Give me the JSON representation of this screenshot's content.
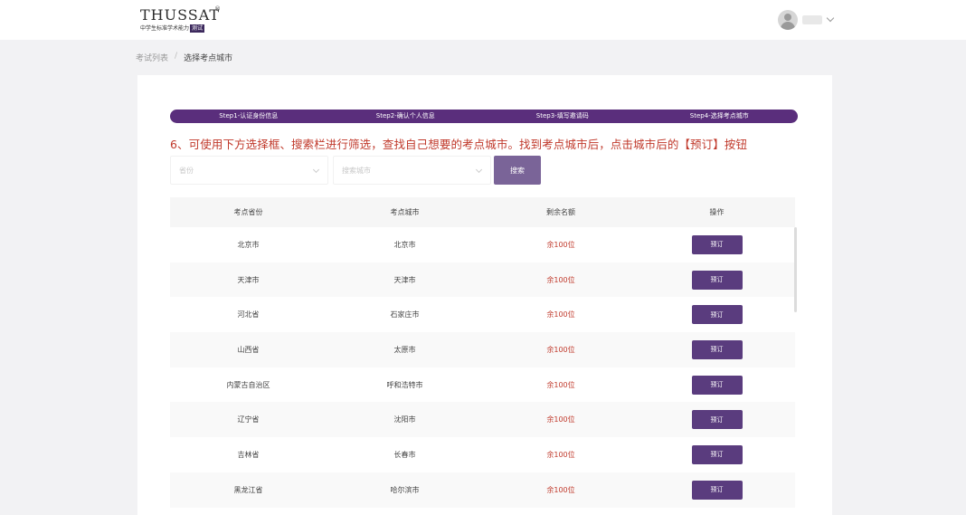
{
  "header": {
    "logo_main": "THUSSAT",
    "logo_reg": "®",
    "logo_subtitle": "中学生标准学术能力",
    "logo_tag": "测试",
    "user_chevron": "chevron-down-icon"
  },
  "breadcrumb": {
    "parent": "考试列表",
    "separator": "/",
    "current": "选择考点城市"
  },
  "steps": [
    {
      "label": "Step1-认证身份信息"
    },
    {
      "label": "Step2-确认个人信息"
    },
    {
      "label": "Step3-填写邀请码"
    },
    {
      "label": "Step4-选择考点城市"
    }
  ],
  "instruction": "6、可使用下方选择框、搜索栏进行筛选，查找自己想要的考点城市。找到考点城市后，点击城市后的【预订】按钮",
  "filters": {
    "province_placeholder": "省份",
    "city_placeholder": "搜索城市",
    "search_label": "搜索"
  },
  "table": {
    "headers": [
      "考点省份",
      "考点城市",
      "剩余名额",
      "操作"
    ],
    "book_label": "预订",
    "rows": [
      {
        "province": "北京市",
        "city": "北京市",
        "remaining": "余100位"
      },
      {
        "province": "天津市",
        "city": "天津市",
        "remaining": "余100位"
      },
      {
        "province": "河北省",
        "city": "石家庄市",
        "remaining": "余100位"
      },
      {
        "province": "山西省",
        "city": "太原市",
        "remaining": "余100位"
      },
      {
        "province": "内蒙古自治区",
        "city": "呼和浩特市",
        "remaining": "余100位"
      },
      {
        "province": "辽宁省",
        "city": "沈阳市",
        "remaining": "余100位"
      },
      {
        "province": "吉林省",
        "city": "长春市",
        "remaining": "余100位"
      },
      {
        "province": "黑龙江省",
        "city": "哈尔滨市",
        "remaining": "余100位"
      }
    ]
  },
  "colors": {
    "brand_purple": "#5a2e7c",
    "button_purple": "#5a3c7e",
    "search_button": "#7a6498",
    "remaining_red": "#c0392b"
  }
}
